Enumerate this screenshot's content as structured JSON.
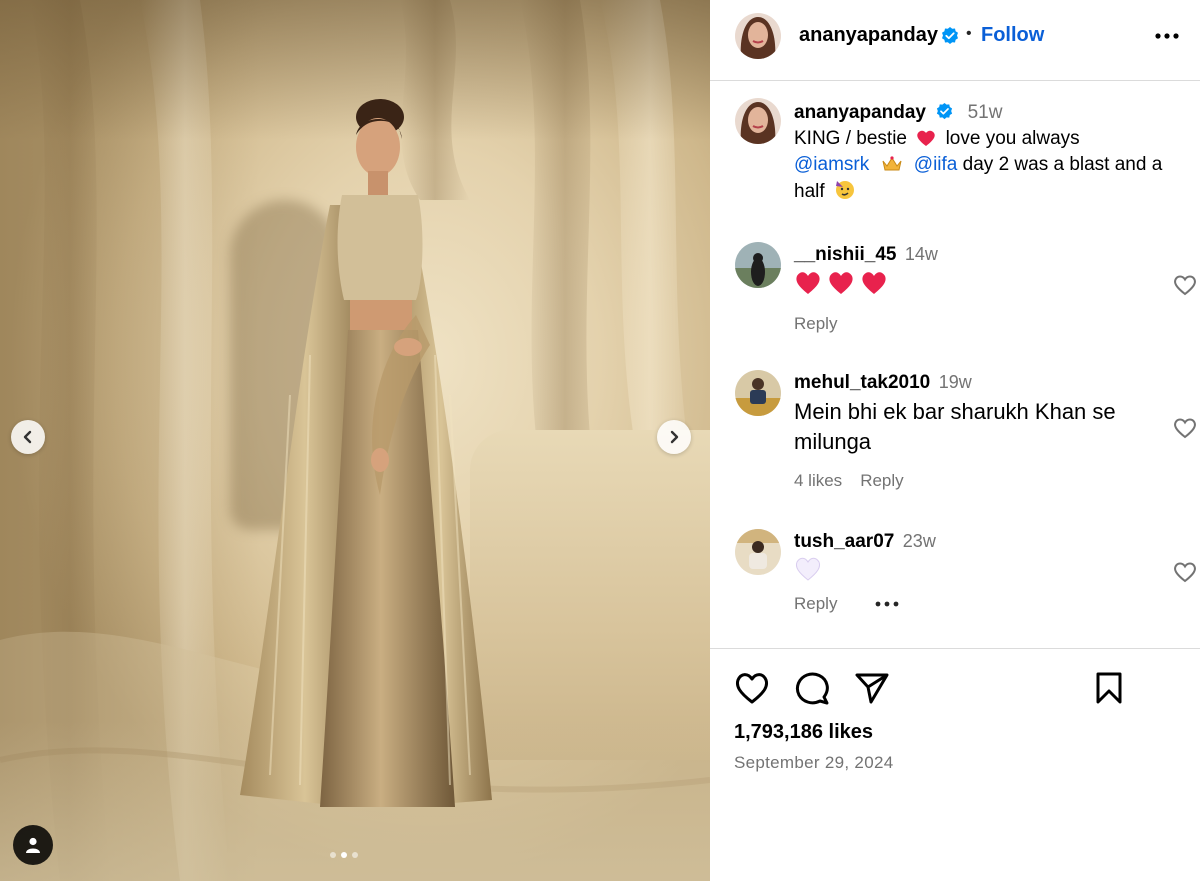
{
  "post": {
    "author": "ananyapanday",
    "follow_label": "Follow",
    "separator": "•",
    "caption": {
      "time": "51w",
      "line1_text": "KING / bestie",
      "line1_after": "love you always",
      "mention1": "@iamsrk",
      "mention2": "@iifa",
      "line2_after": "day 2 was a blast and a half"
    },
    "carousel": {
      "slide_count": 3,
      "active_slide": 2
    },
    "likes_text": "1,793,186 likes",
    "date": "September 29, 2024"
  },
  "comments": [
    {
      "user": "__nishii_45",
      "time": "14w",
      "text": "",
      "emoji": "hearts-x3",
      "likes": "",
      "reply": "Reply"
    },
    {
      "user": "mehul_tak2010",
      "time": "19w",
      "text": "Mein bhi ek bar sharukh Khan se milunga",
      "likes": "4 likes",
      "reply": "Reply"
    },
    {
      "user": "tush_aar07",
      "time": "23w",
      "text": "",
      "emoji": "white-heart",
      "likes": "",
      "reply": "Reply"
    }
  ],
  "icons": {
    "verified": "verified-badge-icon",
    "more": "more-horizontal-icon",
    "like": "heart-icon",
    "comment": "comment-icon",
    "share": "share-icon",
    "save": "bookmark-icon",
    "prev": "chevron-left-icon",
    "next": "chevron-right-icon",
    "tag": "user-tag-icon"
  },
  "colors": {
    "accent": "#0a5fd7",
    "verified": "#0095f6",
    "muted": "#737373",
    "heart_red": "#e8224d"
  }
}
